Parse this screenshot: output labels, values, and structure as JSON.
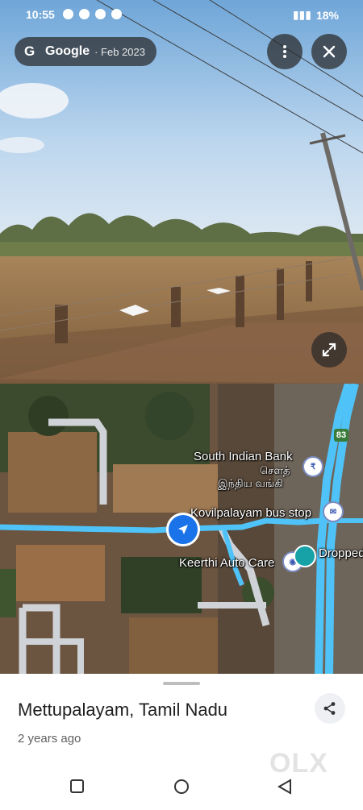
{
  "status_bar": {
    "time": "10:55",
    "battery": "18%"
  },
  "imagery": {
    "provider": "Google",
    "date": "· Feb 2023"
  },
  "map": {
    "route_shield": "83",
    "labels": {
      "bank": "South Indian Bank",
      "bank_tamil_1": "சௌத்",
      "bank_tamil_2": "இந்திய வங்கி",
      "bus_stop": "Kovilpalayam bus stop",
      "auto_care": "Keerthi Auto Care",
      "dropped": "Dropped"
    },
    "icons": {
      "bank": "bank-icon",
      "bus_stop": "mail-icon",
      "auto_care": "pin-icon",
      "dropped": "marker-icon"
    }
  },
  "sheet": {
    "place": "Mettupalayam, Tamil Nadu",
    "time_ago": "2 years ago"
  },
  "watermark": "OLX",
  "colors": {
    "route": "#4fc3f7",
    "sheet_bg": "#ffffff",
    "pill_bg": "#2a2a2a"
  }
}
